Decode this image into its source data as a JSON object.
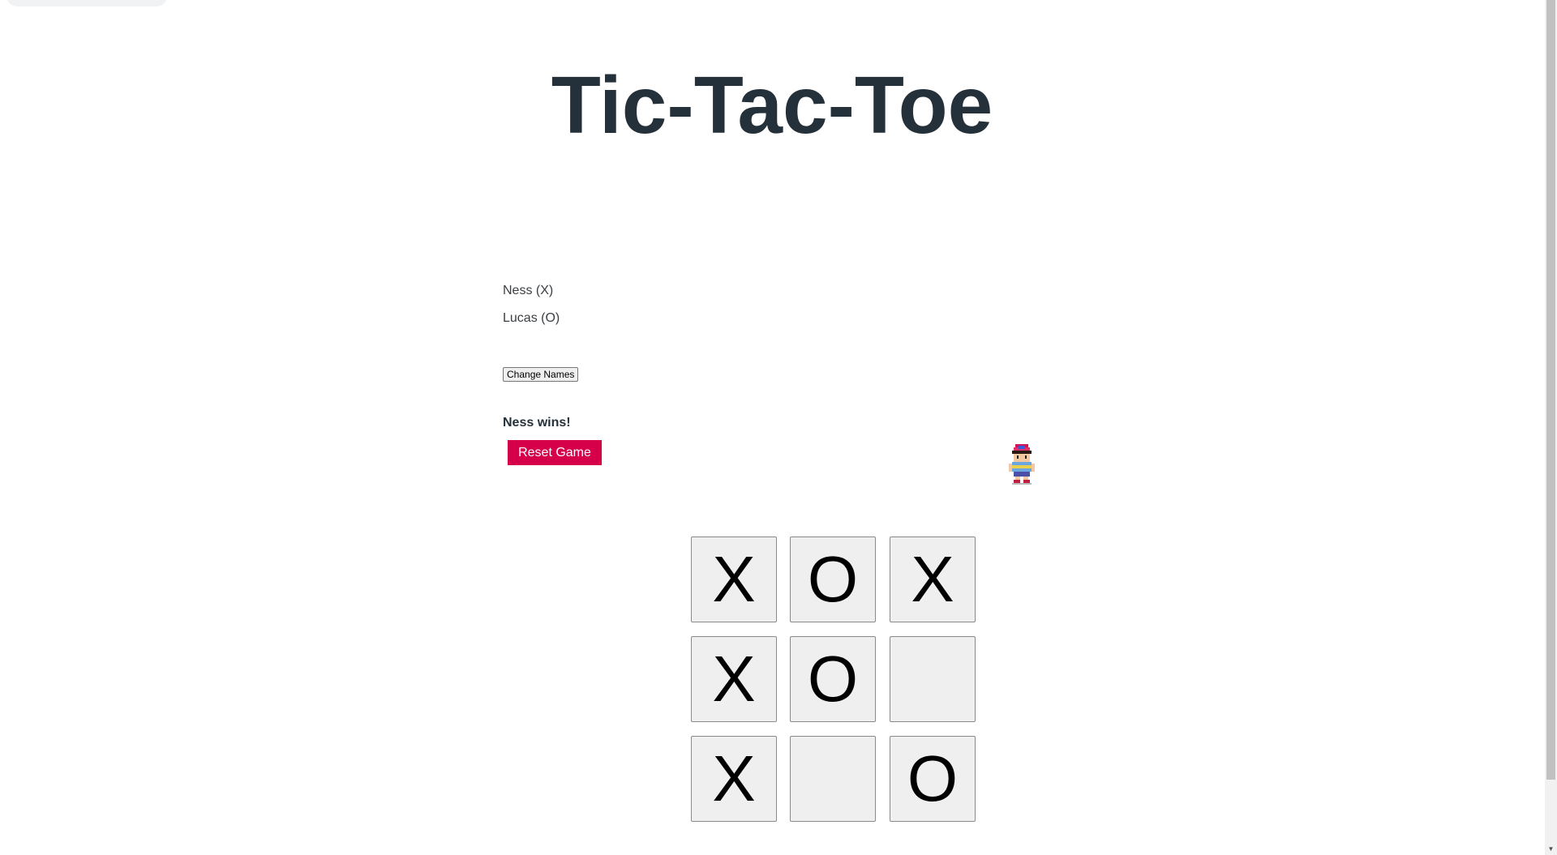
{
  "title": "Tic-Tac-Toe",
  "players": {
    "x_label": "Ness (X)",
    "o_label": "Lucas (O)"
  },
  "change_names_label": "Change Names",
  "status": "Ness wins!",
  "reset_label": "Reset Game",
  "sprite": {
    "icon": "ness-sprite-icon"
  },
  "board": {
    "cells": [
      "X",
      "O",
      "X",
      "X",
      "O",
      "",
      "X",
      "",
      "O"
    ]
  },
  "scrollbar": {
    "down_arrow": "▼"
  },
  "colors": {
    "title": "#25313a",
    "reset_button": "#d6004a",
    "cell_background": "#efefef"
  }
}
